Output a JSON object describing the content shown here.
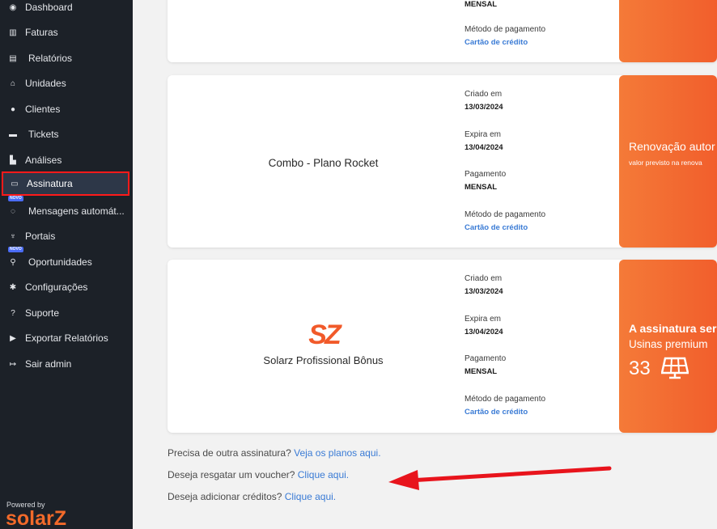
{
  "sidebar": {
    "items": [
      {
        "label": "Dashboard",
        "icon": "dashboard-icon",
        "glyph": "◉"
      },
      {
        "label": "Faturas",
        "icon": "barcode-icon",
        "glyph": "▥"
      },
      {
        "label": "Relatórios",
        "icon": "document-icon",
        "glyph": "▤"
      },
      {
        "label": "Unidades",
        "icon": "home-icon",
        "glyph": "⌂"
      },
      {
        "label": "Clientes",
        "icon": "user-icon",
        "glyph": "●"
      },
      {
        "label": "Tickets",
        "icon": "ticket-icon",
        "glyph": "▬"
      },
      {
        "label": "Análises",
        "icon": "chart-icon",
        "glyph": "▙"
      },
      {
        "label": "Assinatura",
        "icon": "credit-card-icon",
        "glyph": "▭"
      },
      {
        "label": "Mensagens automát...",
        "icon": "whatsapp-icon",
        "glyph": "◌",
        "badge": "NOVO"
      },
      {
        "label": "Portais",
        "icon": "plug-icon",
        "glyph": "♆"
      },
      {
        "label": "Oportunidades",
        "icon": "search-icon",
        "glyph": "⚲",
        "badge": "NOVO"
      },
      {
        "label": "Configurações",
        "icon": "gear-icon",
        "glyph": "✱"
      },
      {
        "label": "Suporte",
        "icon": "question-icon",
        "glyph": "?"
      },
      {
        "label": "Exportar Relatórios",
        "icon": "export-icon",
        "glyph": "▶"
      },
      {
        "label": "Sair admin",
        "icon": "logout-icon",
        "glyph": "↦"
      }
    ],
    "powered_by": "Powered by",
    "logo": "solarZ"
  },
  "cards": [
    {
      "mensal": "MENSAL",
      "metodo_label": "Método de pagamento",
      "metodo_value": "Cartão de crédito"
    },
    {
      "plan": "Combo - Plano Rocket",
      "criado_label": "Criado em",
      "criado_value": "13/03/2024",
      "expira_label": "Expira em",
      "expira_value": "13/04/2024",
      "pagamento_label": "Pagamento",
      "pagamento_value": "MENSAL",
      "metodo_label": "Método de pagamento",
      "metodo_value": "Cartão de crédito",
      "side_title": "Renovação autor",
      "side_sub": "valor previsto na renova"
    },
    {
      "logo": "SZ",
      "plan": "Solarz Profissional Bônus",
      "criado_label": "Criado em",
      "criado_value": "13/03/2024",
      "expira_label": "Expira em",
      "expira_value": "13/04/2024",
      "pagamento_label": "Pagamento",
      "pagamento_value": "MENSAL",
      "metodo_label": "Método de pagamento",
      "metodo_value": "Cartão de crédito",
      "side_title": "A assinatura ser",
      "side_sub": "Usinas premium",
      "side_count": "33"
    }
  ],
  "bottom": {
    "line1_text": "Precisa de outra assinatura?",
    "line1_link": "Veja os planos aqui.",
    "line2_text": "Deseja resgatar um voucher?",
    "line2_link": "Clique aqui.",
    "line3_text": "Deseja adicionar créditos?",
    "line3_link": "Clique aqui."
  },
  "colors": {
    "sidebar_bg": "#1c2128",
    "accent_orange": "#f26a2a",
    "link_blue": "#3a7bd5",
    "highlight_red": "#ff1a1a"
  }
}
